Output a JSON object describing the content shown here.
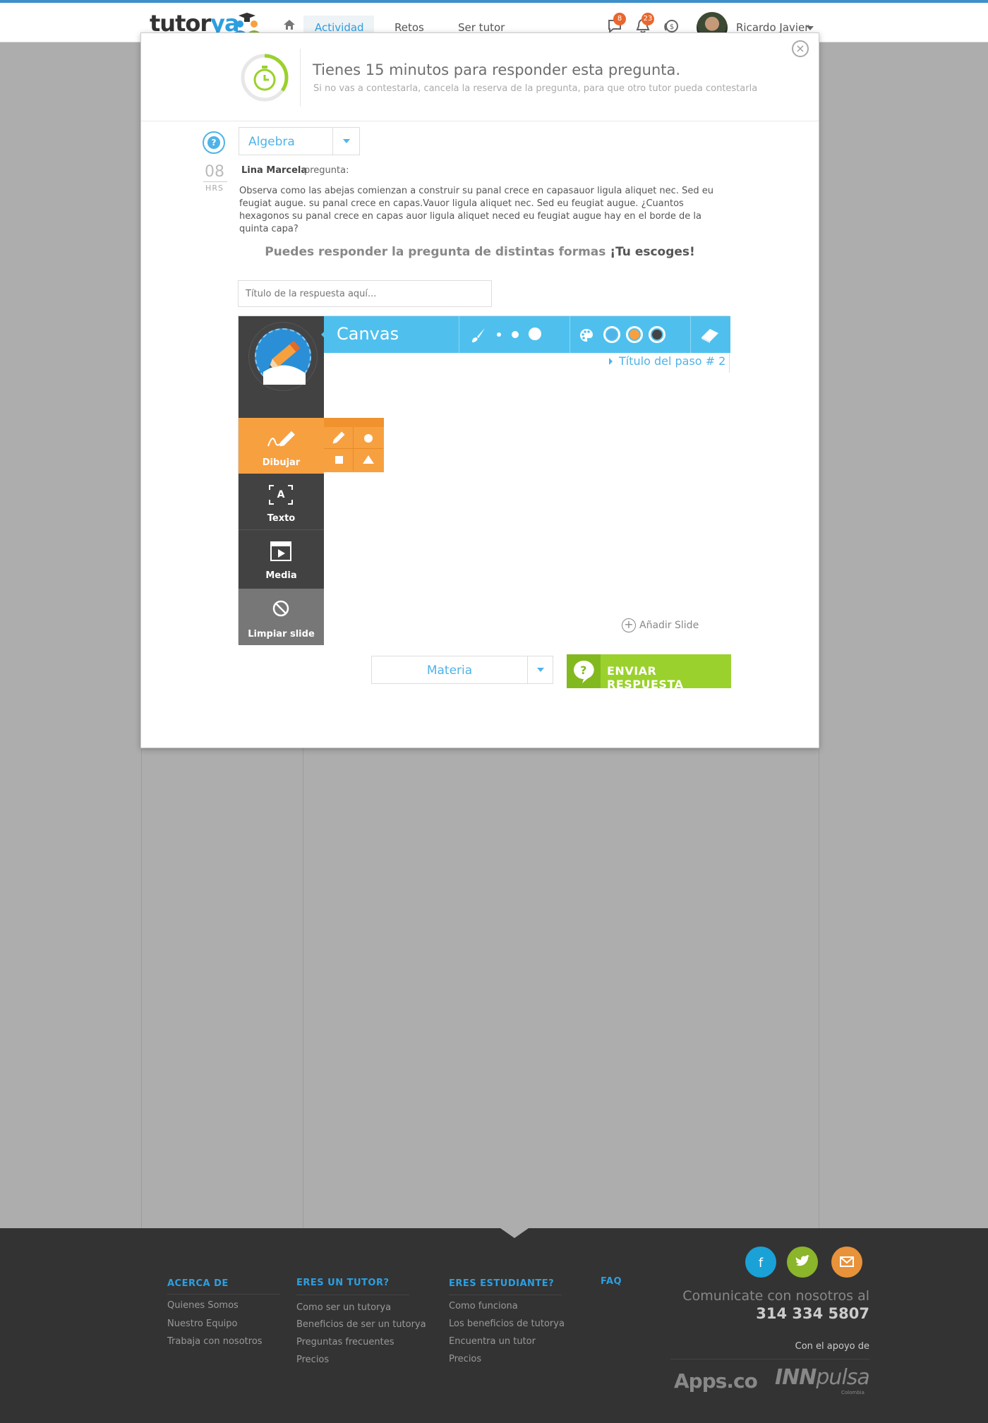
{
  "header": {
    "logo_main": "tutor",
    "logo_accent": "ya",
    "nav": [
      "Actividad",
      "Retos",
      "Ser tutor"
    ],
    "messages_count": "8",
    "notifications_count": "23",
    "user_name": "Ricardo Javier"
  },
  "modal": {
    "title": "Tienes 15 minutos para responder esta pregunta.",
    "subtitle": "Si no vas a contestarla, cancela la reserva de la pregunta, para que otro tutor pueda contestarla",
    "close_symbol": "×",
    "timer_remaining_fraction": 0.35
  },
  "question": {
    "category": "Algebra",
    "hours": "08",
    "hours_label": "HRS",
    "asker": "Lina Marcela",
    "asker_verb": "pregunta:",
    "text": "Observa como las abejas comienzan a construir su panal crece en capasauor ligula aliquet nec. Sed eu feugiat augue. su panal crece en capas.Vauor ligula aliquet nec. Sed eu feugiat augue.  ¿Cuantos hexagonos su panal crece en capas auor ligula aliquet neced eu feugiat augue hay en el borde de la quinta capa?"
  },
  "answer": {
    "prompt_main": "Puedes responder la pregunta de distintas formas ",
    "prompt_emph": "¡Tu escoges!",
    "title_placeholder": "Título de la respuesta aquí...",
    "canvas_title": "Canvas",
    "step_title": "Título del paso # 2",
    "tools": [
      "Dibujar",
      "Texto",
      "Media",
      "Limpiar slide"
    ],
    "add_slide": "Añadir Slide",
    "subject": "Materia",
    "send_label": "ENVIAR RESPUESTA",
    "colors": [
      "#4fb3e8",
      "#f7a040",
      "#444444"
    ]
  },
  "footer": {
    "columns": [
      {
        "heading": "ACERCA DE",
        "links": [
          "Quienes Somos",
          "Nuestro Equipo",
          "Trabaja con nosotros"
        ]
      },
      {
        "heading": "ERES UN TUTOR?",
        "links": [
          "Como ser un tutorya",
          "Beneficios de ser un tutorya",
          "Preguntas frecuentes",
          "Precios"
        ]
      },
      {
        "heading": "ERES ESTUDIANTE?",
        "links": [
          "Como funciona",
          "Los beneficios de tutorya",
          "Encuentra un tutor",
          "Precios"
        ]
      },
      {
        "heading": "FAQ",
        "links": []
      }
    ],
    "contact_label": "Comunicate con nosotros al",
    "phone": "314 334 5807",
    "support_label": "Con el apoyo de",
    "sponsor1": "Apps.co",
    "sponsor2_bold": "INN",
    "sponsor2_rest": "pulsa",
    "sponsor2_sub": "Colombia",
    "social_icons": [
      "facebook-icon",
      "twitter-icon",
      "email-icon"
    ],
    "social_colors": [
      "#1aa1d6",
      "#8bb52a",
      "#e8923a"
    ]
  }
}
